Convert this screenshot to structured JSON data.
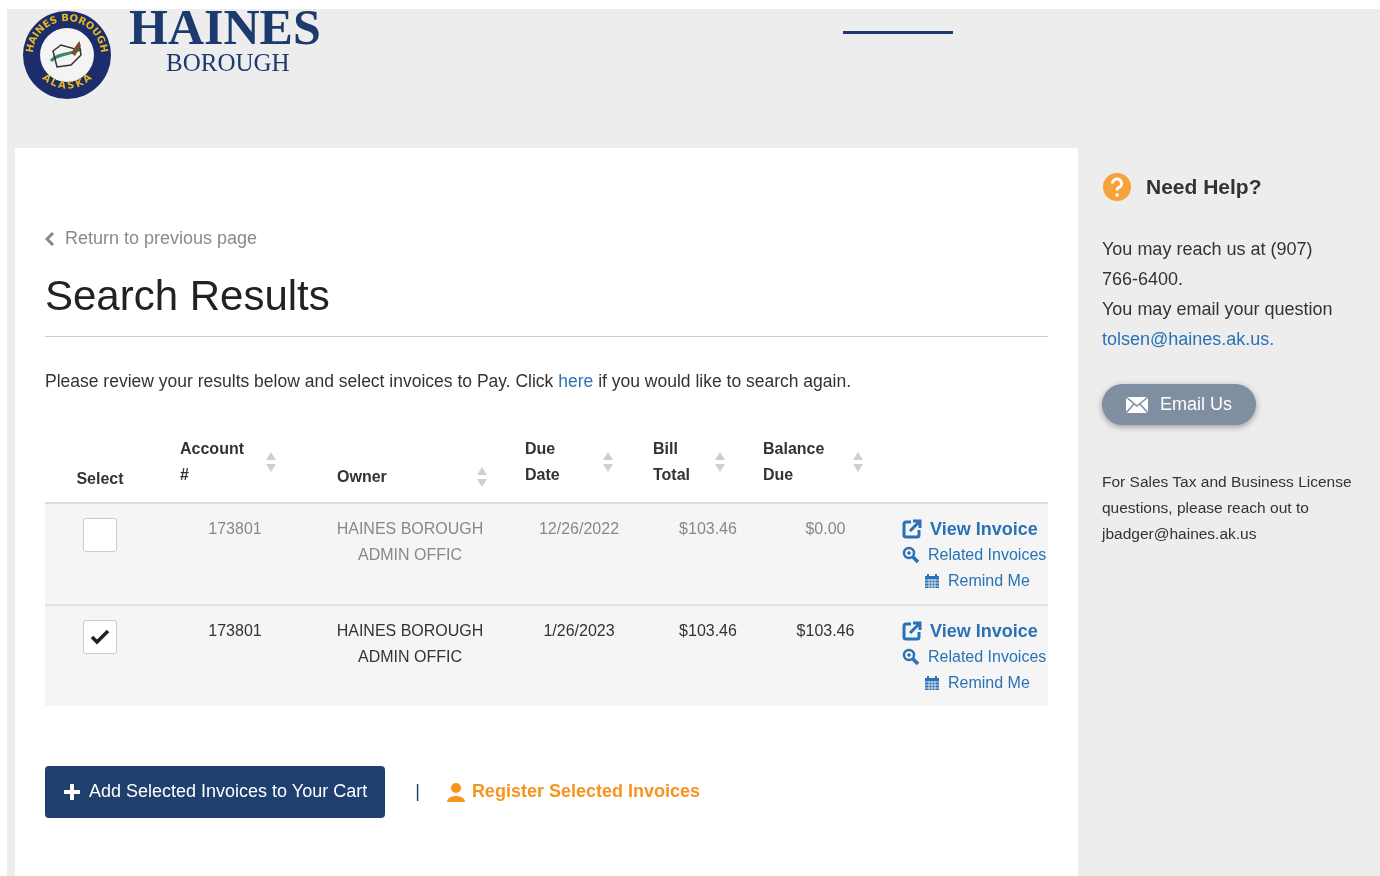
{
  "logo": {
    "seal_top": "HAINES BOROUGH",
    "seal_bottom": "ALASKA",
    "name": "HAINES",
    "subtitle": "BOROUGH"
  },
  "back_link": "Return to previous page",
  "title": "Search Results",
  "intro": {
    "before": "Please review your results below and select invoices to Pay. Click ",
    "link": "here",
    "after": " if you would like to search again."
  },
  "table": {
    "columns": [
      {
        "label": "Select",
        "sortable": false
      },
      {
        "label": "Account #",
        "sortable": true
      },
      {
        "label": "Owner",
        "sortable": true
      },
      {
        "label": "Due Date",
        "sortable": true
      },
      {
        "label": "Bill Total",
        "sortable": true
      },
      {
        "label": "Balance Due",
        "sortable": true
      }
    ],
    "rows": [
      {
        "checked": false,
        "account": "173801",
        "owner": "HAINES BOROUGH ADMIN OFFIC",
        "due_date": "12/26/2022",
        "bill_total": "$103.46",
        "balance_due": "$0.00",
        "view": "View Invoice",
        "related": "Related Invoices",
        "remind": "Remind Me"
      },
      {
        "checked": true,
        "account": "173801",
        "owner": "HAINES BOROUGH ADMIN OFFIC",
        "due_date": "1/26/2023",
        "bill_total": "$103.46",
        "balance_due": "$103.46",
        "view": "View Invoice",
        "related": "Related Invoices",
        "remind": "Remind Me"
      }
    ]
  },
  "add_button": "Add Selected Invoices to Your Cart",
  "separator": "|",
  "register_link": "Register Selected Invoices",
  "help": {
    "title": "Need Help?",
    "phone_text": "You may reach us at (907) 766-6400.",
    "email_text": "You may email your question",
    "email_link": "tolsen@haines.ak.us.",
    "email_button": "Email Us",
    "sales_text": "For Sales Tax and Business License questions, please reach out to jbadger@haines.ak.us"
  }
}
